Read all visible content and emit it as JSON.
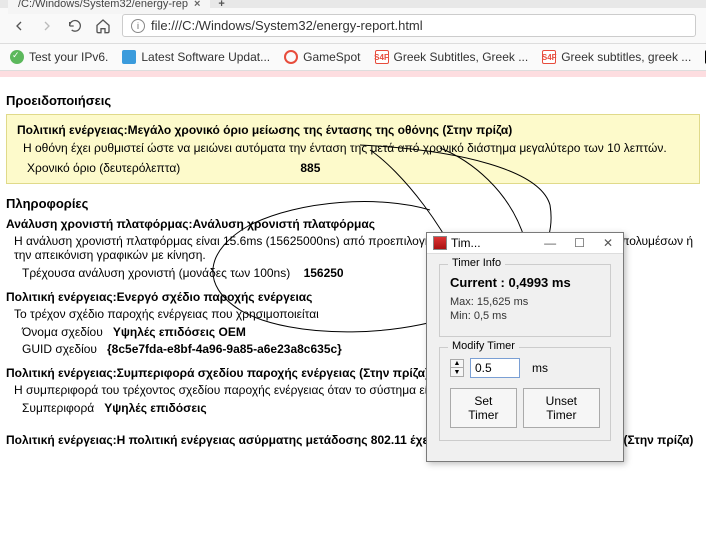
{
  "tab": {
    "title": "/C:/Windows/System32/energy-rep"
  },
  "url": "file:///C:/Windows/System32/energy-report.html",
  "bookmarks": {
    "ipv6": "Test your IPv6.",
    "lsu": "Latest Software Updat...",
    "gamespot": "GameSpot",
    "s4f1": "Greek Subtitles, Greek ...",
    "s4f1_tag": "S4F",
    "s4f2": "Greek subtitles, greek ...",
    "s4f2_tag": "S4F",
    "g": "g"
  },
  "warn_h": "Προειδοποιήσεις",
  "yellow": {
    "title": "Πολιτική ενέργειας:Μεγάλο χρονικό όριο μείωσης της έντασης της οθόνης (Στην πρίζα)",
    "desc": "Η οθόνη έχει ρυθμιστεί ώστε να μειώνει αυτόματα την ένταση της μετά από χρονικό διάστημα μεγαλύτερο των 10 λεπτών.",
    "kv_label": "Χρονικό όριο (δευτερόλεπτα)",
    "kv_val": "885"
  },
  "info_h": "Πληροφορίες",
  "s1": {
    "title": "Ανάλυση χρονιστή πλατφόρμας:Ανάλυση χρονιστή πλατφόρμας",
    "desc": "Η ανάλυση χρονιστή πλατφόρμας είναι 15.6ms (15625000ns) από προεπιλογή... χρησιμοποιείται ή αναπαραγωγή πολυμέσων ή την απεικόνιση γραφικών με κίνηση.",
    "kv_label": "Τρέχουσα ανάλυση χρονιστή (μονάδες των 100ns)",
    "kv_val": "156250"
  },
  "s2": {
    "title": "Πολιτική ενέργειας:Ενεργό σχέδιο παροχής ενέργειας",
    "desc": "Το τρέχον σχέδιο παροχής ενέργειας που χρησιμοποιείται",
    "r1l": "Όνομα σχεδίου",
    "r1v": "Υψηλές επιδόσεις OEM",
    "r2l": "GUID σχεδίου",
    "r2v": "{8c5e7fda-e8bf-4a96-9a85-a6e23a8c635c}"
  },
  "s3": {
    "title": "Πολιτική ενέργειας:Συμπεριφορά σχεδίου παροχής ενέργειας (Στην πρίζα)",
    "desc": "Η συμπεριφορά του τρέχοντος σχεδίου παροχής ενέργειας όταν το σύστημα είναι συνδεδεμένο στην πρίζα.",
    "r1l": "Συμπεριφορά",
    "r1v": "Υψηλές επιδόσεις"
  },
  "s4": {
    "title": "Πολιτική ενέργειας:Η πολιτική ενέργειας ασύρματης μετάδοσης 802.11 έχει ρυθμιστεί σε Μέγιστες επιδόσεις (Στην πρίζα)"
  },
  "timer": {
    "title": "Tim...",
    "group1": "Timer Info",
    "cur_l": "Current :",
    "cur_v": "0,4993 ms",
    "max": "Max: 15,625 ms",
    "min": "Min: 0,5 ms",
    "group2": "Modify Timer",
    "input": "0.5",
    "unit": "ms",
    "btn_set": "Set Timer",
    "btn_unset": "Unset Timer"
  }
}
